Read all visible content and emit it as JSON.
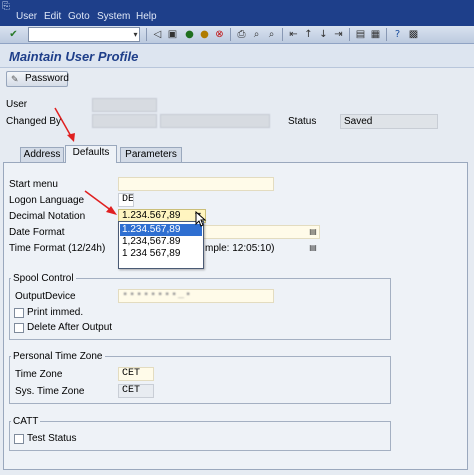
{
  "menubar": {
    "items": [
      "User",
      "Edit",
      "Goto",
      "System",
      "Help"
    ]
  },
  "title": "Maintain User Profile",
  "app_toolbar": {
    "password_label": "Password"
  },
  "header": {
    "user_label": "User",
    "changed_by_label": "Changed By",
    "status_label": "Status",
    "status_value": "Saved"
  },
  "tabs": [
    "Address",
    "Defaults",
    "Parameters"
  ],
  "active_tab": "Defaults",
  "defaults": {
    "start_menu_label": "Start menu",
    "logon_language_label": "Logon Language",
    "logon_language_value": "DE",
    "decimal_notation_label": "Decimal Notation",
    "decimal_notation_value": "1.234.567,89",
    "date_format_label": "Date Format",
    "time_format_label": "Time Format (12/24h)",
    "time_format_partial": "mple: 12:05:10)",
    "decimal_options": [
      "1.234.567,89",
      "1,234,567.89",
      "1 234 567,89"
    ]
  },
  "spool": {
    "title": "Spool Control",
    "output_device_label": "OutputDevice",
    "print_immed_label": "Print immed.",
    "delete_after_output_label": "Delete After Output"
  },
  "timezone": {
    "title": "Personal Time Zone",
    "time_zone_label": "Time Zone",
    "time_zone_value": "CET",
    "sys_time_zone_label": "Sys. Time Zone",
    "sys_time_zone_value": "CET"
  },
  "catt": {
    "title": "CATT",
    "test_status_label": "Test Status"
  },
  "colors": {
    "menubar": "#1e3f8a",
    "title_text": "#1f3f8a",
    "input_bg": "#fffbe9",
    "selection": "#2f6fd1",
    "arrow": "#e02020"
  }
}
